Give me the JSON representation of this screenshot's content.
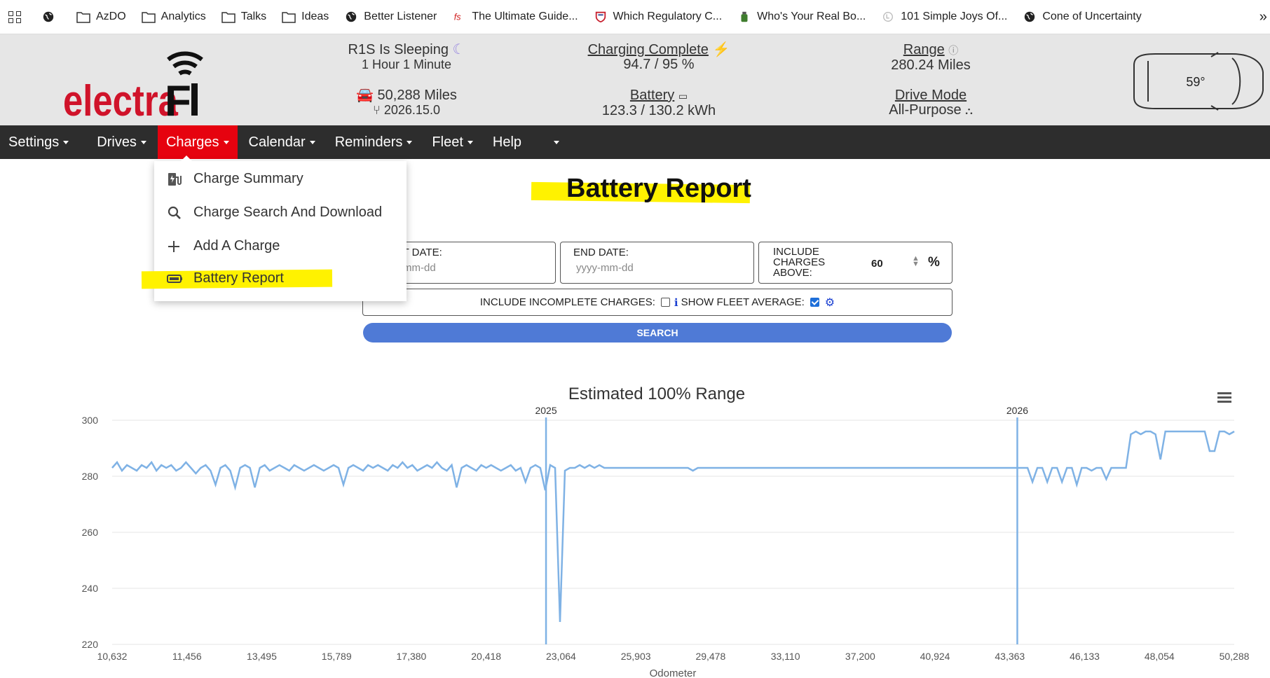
{
  "bookmarks": [
    {
      "label": "AzDO",
      "icon": "folder-icon"
    },
    {
      "label": "Analytics",
      "icon": "folder-icon"
    },
    {
      "label": "Talks",
      "icon": "folder-icon"
    },
    {
      "label": "Ideas",
      "icon": "folder-icon"
    },
    {
      "label": "Better Listener",
      "icon": "globe-icon"
    },
    {
      "label": "The Ultimate Guide...",
      "icon": "fs-icon"
    },
    {
      "label": "Which Regulatory C...",
      "icon": "shield-icon"
    },
    {
      "label": "Who's Your Real Bo...",
      "icon": "bottle-icon"
    },
    {
      "label": "101 Simple Joys Of...",
      "icon": "hand-icon"
    },
    {
      "label": "Cone of Uncertainty",
      "icon": "globe-icon"
    }
  ],
  "header": {
    "logo_text": "electraFi",
    "sleep_title": "R1S Is Sleeping",
    "sleep_duration": "1 Hour 1 Minute",
    "odometer": "50,288 Miles",
    "software": "2026.15.0",
    "charging_label": "Charging Complete",
    "charging_value": "94.7 / 95 %",
    "battery_label": "Battery",
    "battery_value": "123.3 / 130.2 kWh",
    "range_label": "Range",
    "range_value": "280.24 Miles",
    "drive_mode_label": "Drive Mode",
    "drive_mode_value": "All-Purpose",
    "temperature": "59°"
  },
  "nav": {
    "items": [
      "Settings",
      "Drives",
      "Charges",
      "Calendar",
      "Reminders",
      "Fleet",
      "Help"
    ],
    "active": "Charges"
  },
  "dropdown": {
    "items": [
      "Charge Summary",
      "Charge Search And Download",
      "Add A Charge",
      "Battery Report"
    ]
  },
  "page": {
    "title": "Battery Report",
    "start_date_label": "START DATE:",
    "start_date_placeholder": "yyyy-mm-dd",
    "end_date_label": "END DATE:",
    "end_date_placeholder": "yyyy-mm-dd",
    "include_label_1": "INCLUDE",
    "include_label_2": "CHARGES",
    "include_label_3": "ABOVE:",
    "include_value": "60",
    "include_unit": "%",
    "incomplete_label": "INCLUDE INCOMPLETE CHARGES:",
    "incomplete_checked": false,
    "fleet_label": "SHOW FLEET AVERAGE:",
    "fleet_checked": true,
    "search_label": "SEARCH"
  },
  "colors": {
    "accent": "#e6020f",
    "nav_bg": "#2d2d2d",
    "header_bg": "#e6e6e6",
    "button": "#4f7ad6",
    "line": "#7fb2e5",
    "highlight": "#fff200"
  },
  "chart_data": {
    "type": "line",
    "title": "Estimated 100% Range",
    "xlabel": "Odometer",
    "ylabel": "",
    "ylim": [
      220,
      300
    ],
    "yticks": [
      220,
      240,
      260,
      280,
      300
    ],
    "x_tick_labels": [
      "10,632",
      "11,456",
      "13,495",
      "15,789",
      "17,380",
      "20,418",
      "23,064",
      "25,903",
      "29,478",
      "33,110",
      "37,200",
      "40,924",
      "43,363",
      "46,133",
      "48,054",
      "50,288"
    ],
    "year_markers": [
      {
        "label": "2025",
        "tick_index": 5.8
      },
      {
        "label": "2026",
        "tick_index": 12.1
      }
    ],
    "grid": true,
    "series": [
      {
        "values": [
          283,
          285,
          282,
          284,
          283,
          282,
          284,
          283,
          285,
          282,
          284,
          283,
          284,
          282,
          283,
          285,
          283,
          281,
          283,
          284,
          282,
          277,
          283,
          284,
          282,
          276,
          283,
          284,
          283,
          276,
          283,
          284,
          282,
          283,
          284,
          283,
          282,
          284,
          283,
          282,
          283,
          284,
          283,
          282,
          283,
          284,
          283,
          277,
          283,
          284,
          283,
          282,
          284,
          283,
          284,
          283,
          282,
          284,
          283,
          285,
          283,
          284,
          282,
          283,
          284,
          283,
          285,
          283,
          282,
          284,
          276,
          283,
          284,
          283,
          282,
          284,
          283,
          284,
          283,
          282,
          283,
          284,
          282,
          283,
          278,
          283,
          284,
          283,
          275,
          284,
          283,
          228,
          282,
          283,
          283,
          284,
          283,
          284,
          283,
          284,
          283,
          283,
          283,
          283,
          283,
          283,
          283,
          283,
          283,
          283,
          283,
          283,
          283,
          283,
          283,
          283,
          283,
          283,
          282,
          283,
          283,
          283,
          283,
          283,
          283,
          283,
          283,
          283,
          283,
          283,
          283,
          283,
          283,
          283,
          283,
          283,
          283,
          283,
          283,
          283,
          283,
          283,
          283,
          283,
          283,
          283,
          283,
          283,
          283,
          283,
          283,
          283,
          283,
          283,
          283,
          283,
          283,
          283,
          283,
          283,
          283,
          283,
          283,
          283,
          283,
          283,
          283,
          283,
          283,
          283,
          283,
          283,
          283,
          283,
          283,
          283,
          283,
          283,
          283,
          283,
          283,
          283,
          283,
          283,
          283,
          283,
          283,
          278,
          283,
          283,
          278,
          283,
          283,
          278,
          283,
          283,
          277,
          283,
          283,
          282,
          283,
          283,
          279,
          283,
          283,
          283,
          283,
          295,
          296,
          295,
          296,
          296,
          295,
          286,
          296,
          296,
          296,
          296,
          296,
          296,
          296,
          296,
          296,
          289,
          289,
          296,
          296,
          295,
          296
        ]
      }
    ]
  }
}
